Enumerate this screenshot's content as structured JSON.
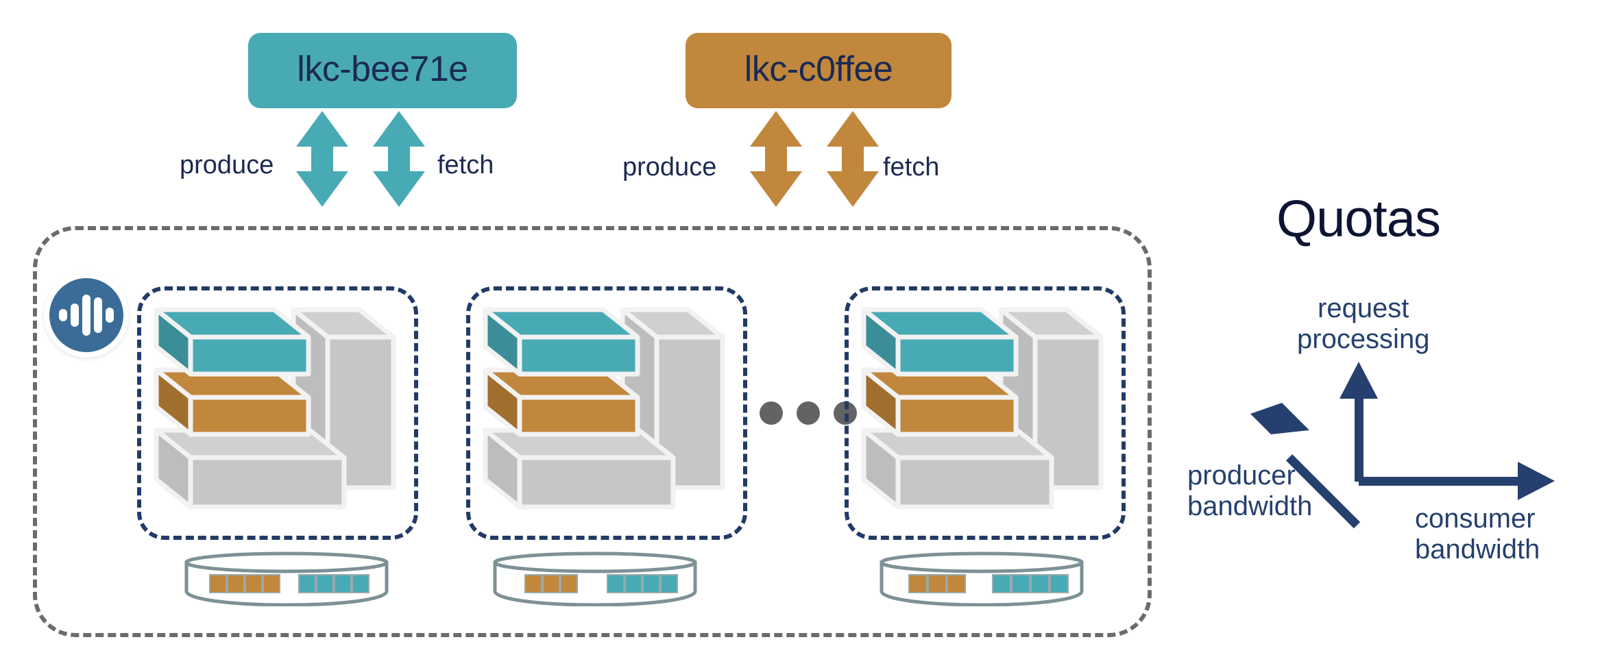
{
  "diagram": {
    "title": "Quotas",
    "colors": {
      "teal": "#48aab5",
      "ochre": "#c1873c",
      "navy": "#223a66",
      "navy_text": "#1b2a52",
      "title_navy": "#0d1433",
      "gray": "#c6c6c6",
      "dashed_gray": "#6b6b6b",
      "logo_blue": "#3a6c97",
      "disk_outline": "#7d9196",
      "dot_gray": "#636363"
    }
  },
  "clusters": [
    {
      "id": "cluster-bee71e",
      "label": "lkc-bee71e",
      "color": "#48aab5",
      "flows": {
        "produce": "produce",
        "fetch": "fetch"
      }
    },
    {
      "id": "cluster-c0ffee",
      "label": "lkc-c0ffee",
      "color": "#c1873c",
      "flows": {
        "produce": "produce",
        "fetch": "fetch"
      }
    }
  ],
  "cluster_box": {
    "logo_icon": "confluent-logo-icon",
    "logo_bar_heights": [
      18,
      34,
      60,
      52,
      22
    ],
    "ellipsis_icon": "ellipsis-dots-icon",
    "ellipsis_dot_count": 3
  },
  "brokers": [
    {
      "id": "broker-1",
      "slabs": [
        {
          "name": "teal-slab",
          "color": "#48aab5"
        },
        {
          "name": "ochre-slab",
          "color": "#c1873c"
        },
        {
          "name": "gray-base-slab",
          "color": "#c6c6c6"
        },
        {
          "name": "gray-wall",
          "color": "#c6c6c6"
        }
      ],
      "disk": {
        "ochre_segments": 4,
        "teal_segments": 4
      }
    },
    {
      "id": "broker-2",
      "slabs": [
        {
          "name": "teal-slab",
          "color": "#48aab5"
        },
        {
          "name": "ochre-slab",
          "color": "#c1873c"
        },
        {
          "name": "gray-base-slab",
          "color": "#c6c6c6"
        },
        {
          "name": "gray-wall",
          "color": "#c6c6c6"
        }
      ],
      "disk": {
        "ochre_segments": 3,
        "teal_segments": 4
      }
    },
    {
      "id": "broker-3",
      "slabs": [
        {
          "name": "teal-slab",
          "color": "#48aab5"
        },
        {
          "name": "ochre-slab",
          "color": "#c1873c"
        },
        {
          "name": "gray-base-slab",
          "color": "#c6c6c6"
        },
        {
          "name": "gray-wall",
          "color": "#c6c6c6"
        }
      ],
      "disk": {
        "ochre_segments": 3,
        "teal_segments": 4
      }
    }
  ],
  "quotas": {
    "title": "Quotas",
    "axes": [
      {
        "id": "axis-request-processing",
        "label": "request\nprocessing",
        "direction": "up"
      },
      {
        "id": "axis-producer-bandwidth",
        "label": "producer\nbandwidth",
        "direction": "up-left"
      },
      {
        "id": "axis-consumer-bandwidth",
        "label": "consumer\nbandwidth",
        "direction": "right"
      }
    ]
  }
}
